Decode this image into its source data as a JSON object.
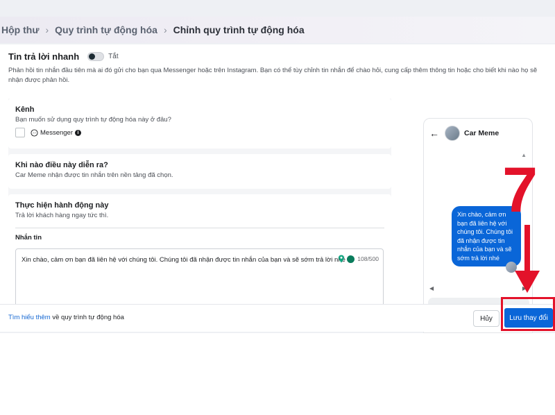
{
  "breadcrumb": {
    "items": [
      "Hộp thư",
      "Quy trình tự động hóa"
    ],
    "current": "Chỉnh quy trình tự động hóa"
  },
  "header": {
    "title": "Tin trả lời nhanh",
    "toggle_state": "Tắt",
    "toggle_on": false,
    "description": "Phản hồi tin nhắn đầu tiên mà ai đó gửi cho bạn qua Messenger hoặc trên Instagram. Bạn có thể tùy chỉnh tin nhắn để chào hỏi, cung cấp thêm thông tin hoặc cho biết khi nào họ sẽ nhận được phản hồi."
  },
  "channel_card": {
    "title": "Kênh",
    "subtitle": "Bạn muốn sử dụng quy trình tự động hóa này ở đâu?",
    "option_label": "Messenger",
    "option_icon": "messenger-icon"
  },
  "trigger_card": {
    "title": "Khi nào điều này diễn ra?",
    "subtitle": "Car Meme nhận được tin nhắn trên nền tảng đã chọn."
  },
  "action_card": {
    "title": "Thực hiện hành động này",
    "subtitle": "Trả lời khách hàng ngay tức thì.",
    "message_label": "Nhắn tin",
    "message_text": "Xin chào, cảm ơn bạn đã liên hệ với chúng tôi. Chúng tôi đã nhận được tin nhắn của bạn và sẽ sớm trả lời nhé",
    "char_count": "108/500"
  },
  "preview": {
    "page_name": "Car Meme",
    "bubble_text": "Xin chào, cảm ơn bạn đã liên hệ với chúng tôi. Chúng tôi đã nhận được tin nhắn của bạn và sẽ sớm trả lời nhé"
  },
  "footer": {
    "learn_more_link": "Tìm hiểu thêm",
    "learn_more_rest": " về quy trình tự động hóa",
    "cancel_label": "Hủy",
    "save_label": "Lưu thay đổi"
  },
  "annotation": {
    "step_number": "7",
    "color": "#e3122a"
  },
  "colors": {
    "accent": "#0a66d8",
    "link": "#1467d2",
    "annotation_red": "#e3122a"
  }
}
